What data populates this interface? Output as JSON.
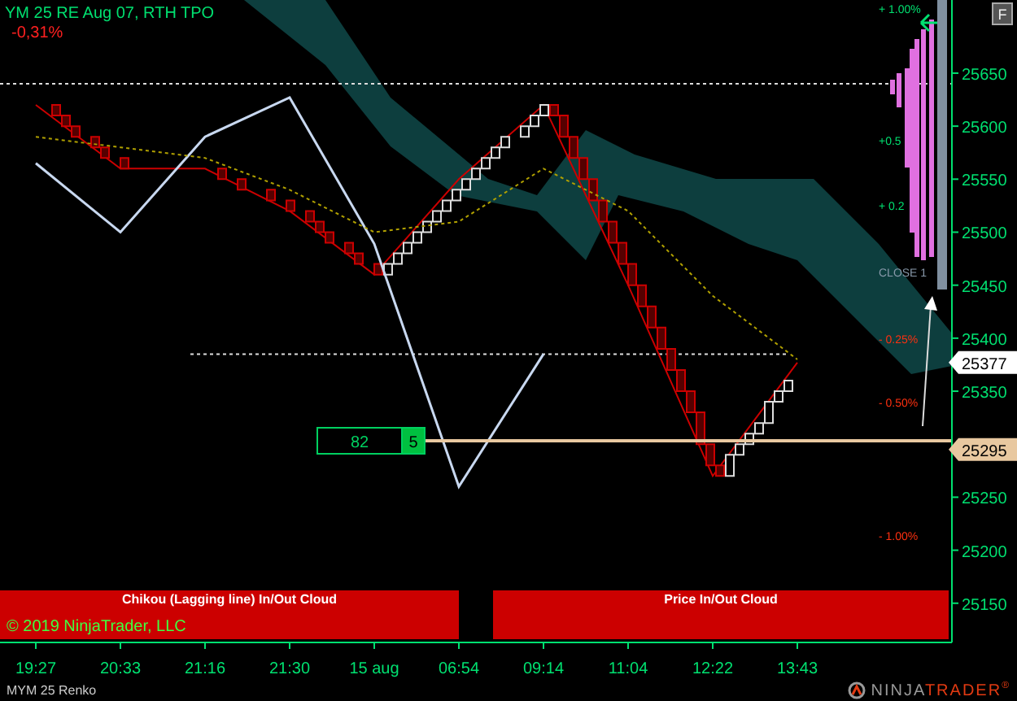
{
  "instrument_title": "YM 25 RE Aug 07, RTH TPO",
  "change": "-0,31%",
  "flags_button": "F",
  "percent_labels": [
    {
      "text": "+ 1.00%",
      "kind": "up"
    },
    {
      "text": "+0.5",
      "kind": "up"
    },
    {
      "text": "+ 0.2",
      "kind": "up"
    },
    {
      "text": "- 0.25%",
      "kind": "down"
    },
    {
      "text": "- 0.50%",
      "kind": "down"
    },
    {
      "text": "- 1.00%",
      "kind": "down"
    }
  ],
  "close_label": "CLOSE 1",
  "price_tags": [
    {
      "text": "25377",
      "kind": "last"
    },
    {
      "text": "25295",
      "kind": "level"
    }
  ],
  "counter_box": {
    "value": "82",
    "badge": "5"
  },
  "panels": [
    {
      "title": "Chikou (Lagging line) In/Out Cloud"
    },
    {
      "title": "Price In/Out Cloud"
    }
  ],
  "copyright": "© 2019 NinjaTrader, LLC",
  "chart_data": {
    "type": "line",
    "categories": [
      "19:27",
      "20:33",
      "21:16",
      "21:30",
      "15 aug",
      "06:54",
      "09:14",
      "11:04",
      "12:22",
      "13:43"
    ],
    "series": [
      {
        "color": "#cc0000",
        "values": [
          25620,
          25560,
          25560,
          25520,
          25460,
          25550,
          25620,
          25450,
          25270,
          25377
        ]
      },
      {
        "color": "#c8d8f0",
        "values": [
          25565,
          25500,
          25590,
          25627,
          25489,
          25260,
          25385,
          null,
          null,
          null
        ]
      },
      {
        "color": "#b0a000",
        "line_style": "dashed",
        "values": [
          25590,
          25580,
          25570,
          25540,
          25500,
          25510,
          25560,
          25520,
          25440,
          25380
        ]
      }
    ],
    "ref_lines": [
      {
        "axis": "y",
        "value": 25640,
        "color": "#dddddd",
        "line_style": "dotted"
      },
      {
        "axis": "y",
        "value": 25385,
        "color": "#dddddd",
        "line_style": "dotted"
      }
    ],
    "ylim": [
      25113,
      25719
    ],
    "yticks": [
      25150,
      25200,
      25250,
      25350,
      25400,
      25450,
      25500,
      25550,
      25600,
      25650
    ]
  },
  "footer": {
    "instrument": "MYM 25 Renko",
    "logo_left": "NINJA",
    "logo_right": "TRADER",
    "trademark": "®"
  }
}
